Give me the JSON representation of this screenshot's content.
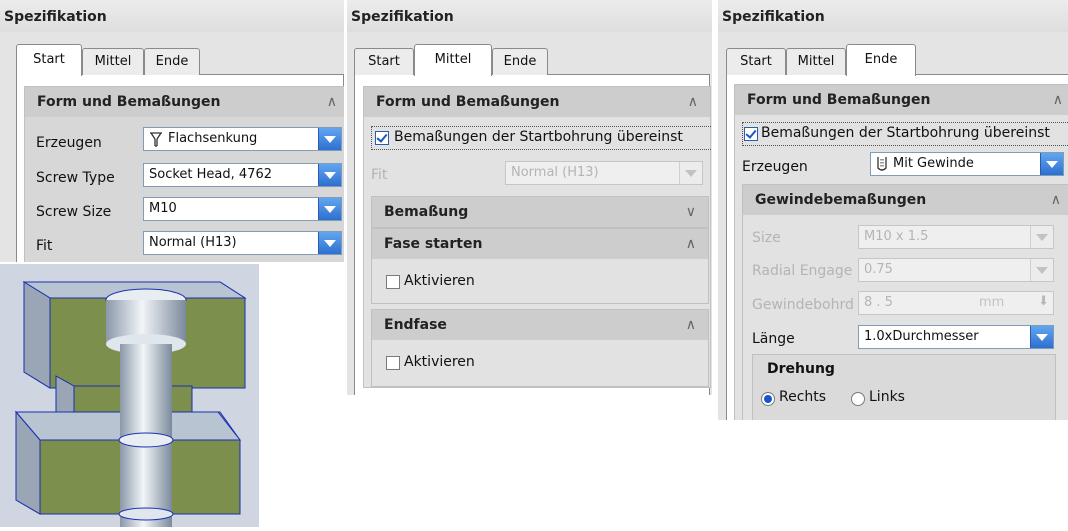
{
  "panels": [
    {
      "title": "Spezifikation",
      "tabs": [
        "Start",
        "Mittel",
        "Ende"
      ],
      "active_tab": "Start",
      "section_title": "Form und Bemaßungen",
      "rows": [
        {
          "label": "Erzeugen",
          "value": "Flachsenkung",
          "icon": "countersink-icon"
        },
        {
          "label": "Screw Type",
          "value": "Socket Head, 4762"
        },
        {
          "label": "Screw Size",
          "value": "M10"
        },
        {
          "label": "Fit",
          "value": "Normal (H13)"
        }
      ]
    },
    {
      "title": "Spezifikation",
      "tabs": [
        "Start",
        "Mittel",
        "Ende"
      ],
      "active_tab": "Mittel",
      "section_title": "Form und Bemaßungen",
      "match_checkbox": "Bemaßungen der Startbohrung übereinst",
      "fit_label": "Fit",
      "fit_value": "Normal (H13)",
      "dim_section": "Bemaßung",
      "chamfer_start": "Fase starten",
      "activate_label": "Aktivieren",
      "end_chamfer": "Endfase",
      "activate_label2": "Aktivieren"
    },
    {
      "title": "Spezifikation",
      "tabs": [
        "Start",
        "Mittel",
        "Ende"
      ],
      "active_tab": "Ende",
      "section_title": "Form und Bemaßungen",
      "match_checkbox": "Bemaßungen der Startbohrung übereinst",
      "create_label": "Erzeugen",
      "create_value": "Mit Gewinde",
      "thread_section": "Gewindebemaßungen",
      "size_label": "Size",
      "size_value": "M10 x 1.5",
      "radial_label": "Radial Engage",
      "radial_value": "0.75",
      "drill_label": "Gewindebohrd",
      "drill_value": "8 . 5",
      "drill_unit": "mm",
      "length_label": "Länge",
      "length_value": "1.0xDurchmesser",
      "rotation_title": "Drehung",
      "right_label": "Rechts",
      "left_label": "Links"
    }
  ],
  "colors": {
    "accent": "#2d6fcf",
    "check": "#1a55c8",
    "solid_face": "#7d8f4c",
    "solid_edge": "#a8b6c6"
  },
  "icons": {
    "dropdown": "chevron-down-icon",
    "expand": "chevron-up-icon",
    "collapse": "chevron-down-icon"
  }
}
